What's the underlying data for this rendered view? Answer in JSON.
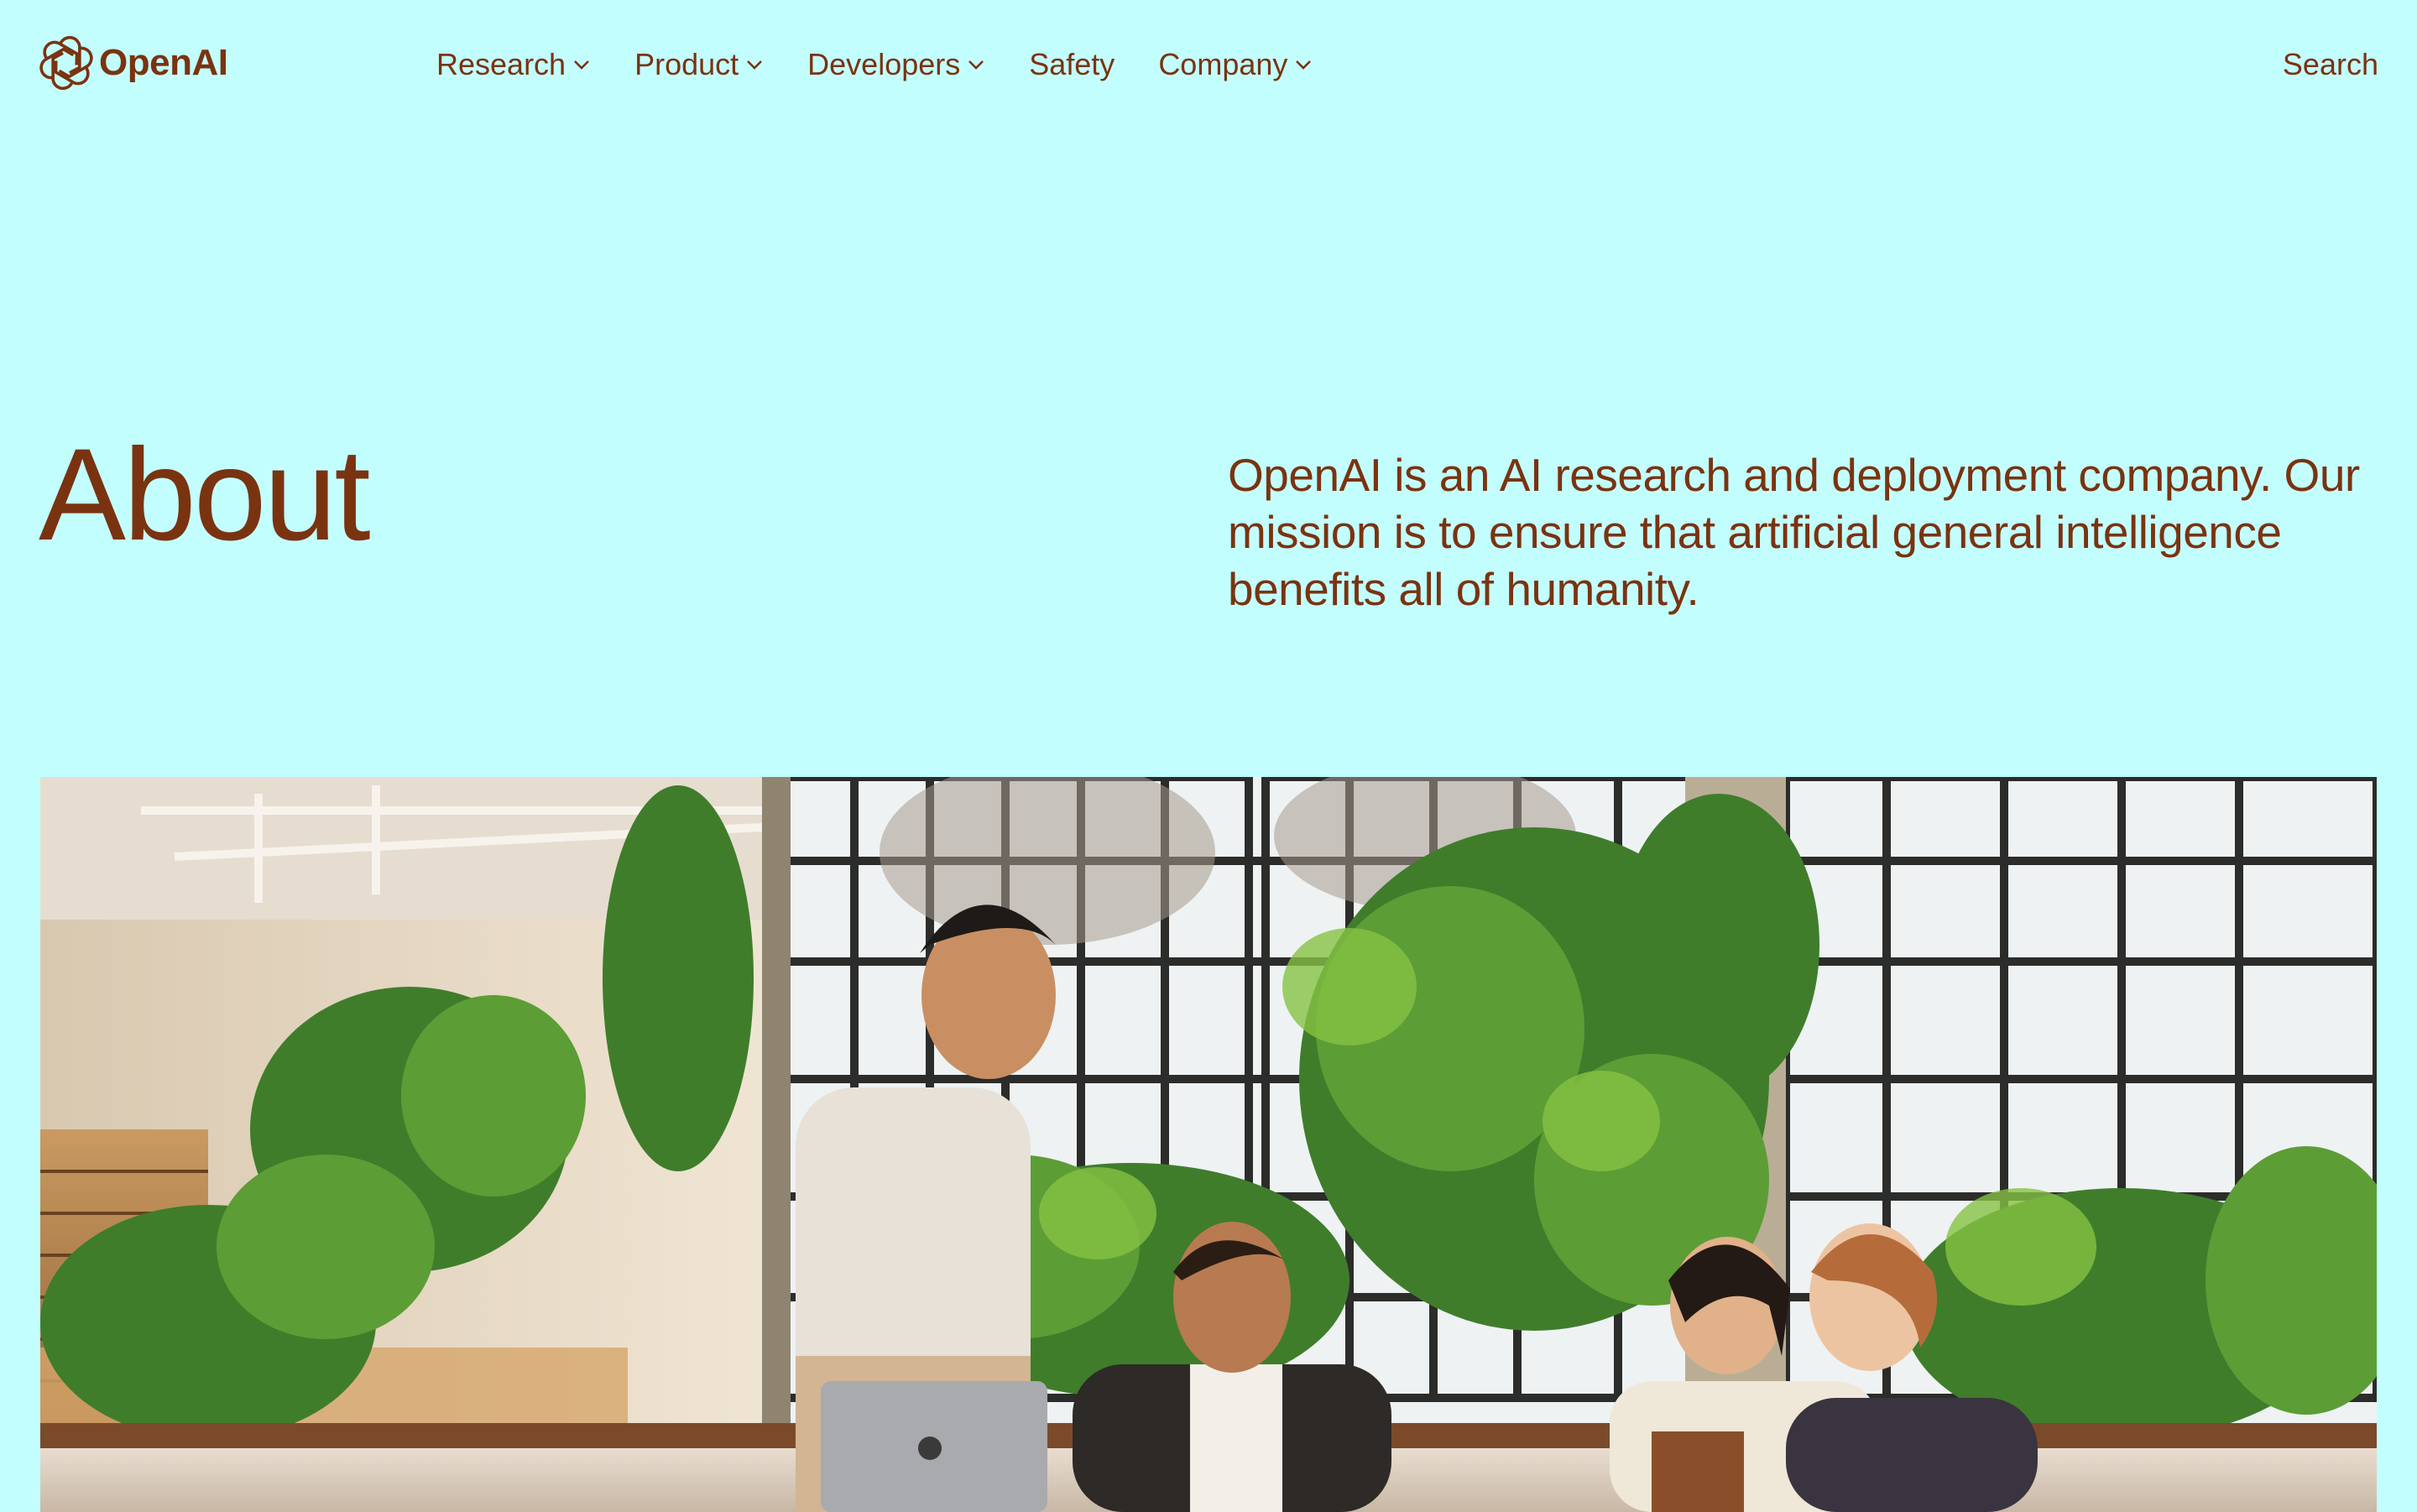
{
  "brand": {
    "name": "OpenAI",
    "icon": "openai-logo-icon"
  },
  "nav": {
    "items": [
      {
        "label": "Research",
        "has_dropdown": true
      },
      {
        "label": "Product",
        "has_dropdown": true
      },
      {
        "label": "Developers",
        "has_dropdown": true
      },
      {
        "label": "Safety",
        "has_dropdown": false
      },
      {
        "label": "Company",
        "has_dropdown": true
      }
    ],
    "search_label": "Search"
  },
  "hero": {
    "title": "About",
    "description": "OpenAI is an AI research and deployment company. Our mission is to ensure that artificial general intelligence benefits all of humanity."
  },
  "colors": {
    "background": "#c3feff",
    "text": "#7a3310"
  }
}
